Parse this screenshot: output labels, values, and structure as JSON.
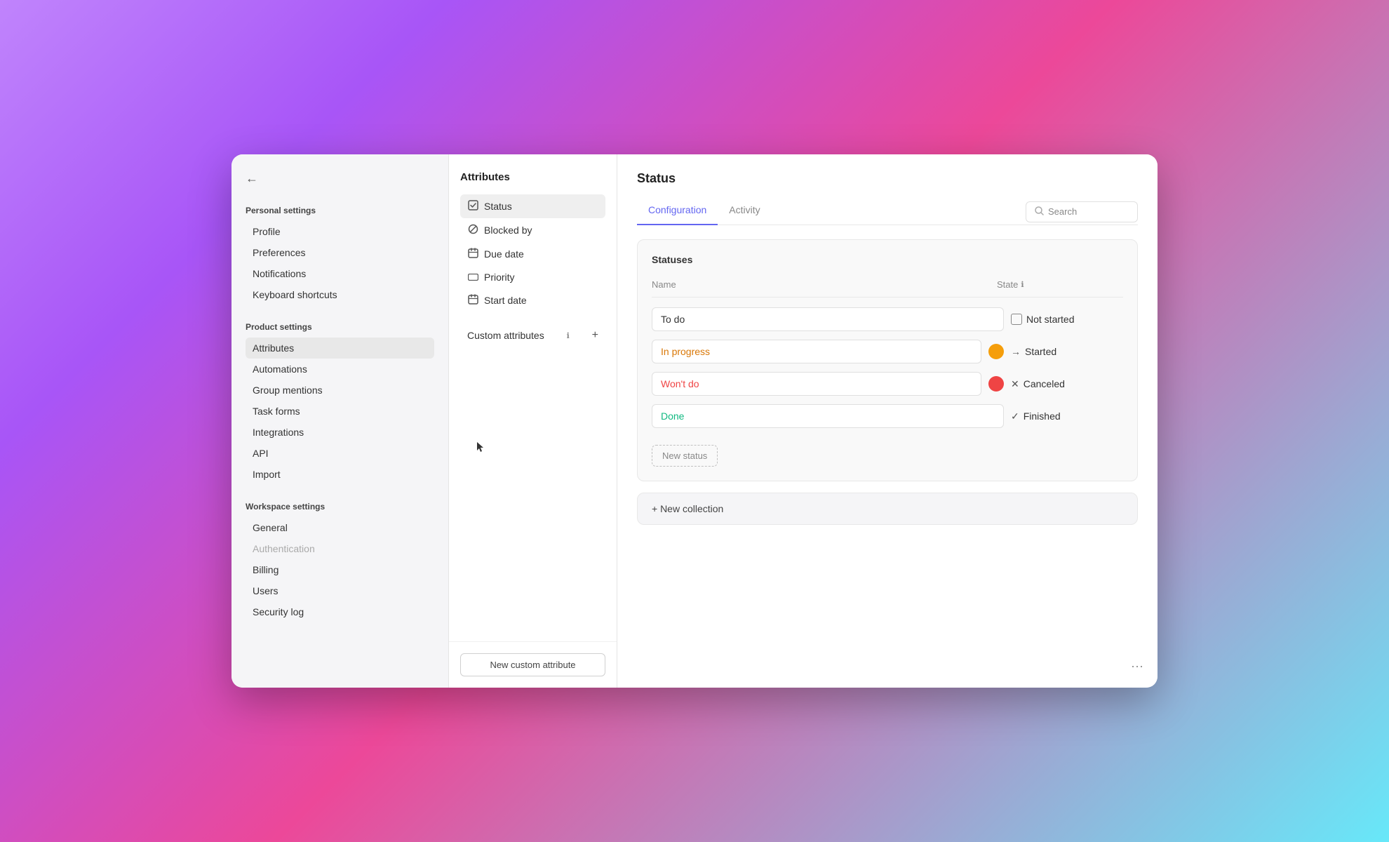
{
  "window": {
    "background": "gradient"
  },
  "sidebar": {
    "back_icon": "←",
    "personal_settings": {
      "title": "Personal settings",
      "items": [
        {
          "label": "Profile",
          "active": false,
          "muted": false
        },
        {
          "label": "Preferences",
          "active": false,
          "muted": false
        },
        {
          "label": "Notifications",
          "active": false,
          "muted": false
        },
        {
          "label": "Keyboard shortcuts",
          "active": false,
          "muted": false
        }
      ]
    },
    "product_settings": {
      "title": "Product settings",
      "items": [
        {
          "label": "Attributes",
          "active": true,
          "muted": false
        },
        {
          "label": "Automations",
          "active": false,
          "muted": false
        },
        {
          "label": "Group mentions",
          "active": false,
          "muted": false
        },
        {
          "label": "Task forms",
          "active": false,
          "muted": false
        },
        {
          "label": "Integrations",
          "active": false,
          "muted": false
        },
        {
          "label": "API",
          "active": false,
          "muted": false
        },
        {
          "label": "Import",
          "active": false,
          "muted": false
        }
      ]
    },
    "workspace_settings": {
      "title": "Workspace settings",
      "items": [
        {
          "label": "General",
          "active": false,
          "muted": false
        },
        {
          "label": "Authentication",
          "active": false,
          "muted": true
        },
        {
          "label": "Billing",
          "active": false,
          "muted": false
        },
        {
          "label": "Users",
          "active": false,
          "muted": false
        },
        {
          "label": "Security log",
          "active": false,
          "muted": false
        }
      ]
    }
  },
  "middle_panel": {
    "title": "Attributes",
    "items": [
      {
        "label": "Status",
        "icon": "☑",
        "active": true
      },
      {
        "label": "Blocked by",
        "icon": "⊘",
        "active": false
      },
      {
        "label": "Due date",
        "icon": "📅",
        "active": false
      },
      {
        "label": "Priority",
        "icon": "▭",
        "active": false
      },
      {
        "label": "Start date",
        "icon": "📅",
        "active": false
      }
    ],
    "custom_attributes": {
      "label": "Custom attributes",
      "info_label": "ℹ",
      "add_label": "+"
    },
    "new_custom_attribute_btn": "New custom attribute"
  },
  "main": {
    "title": "Status",
    "tabs": [
      {
        "label": "Configuration",
        "active": true
      },
      {
        "label": "Activity",
        "active": false
      }
    ],
    "search": {
      "placeholder": "Search",
      "icon": "🔍"
    },
    "statuses_card": {
      "title": "Statuses",
      "columns": {
        "name": "Name",
        "state": "State",
        "state_info": "ℹ"
      },
      "rows": [
        {
          "name": "To do",
          "name_color": "default",
          "dot_color": null,
          "state_icon": "□",
          "state_label": "Not started",
          "state_type": "not_started"
        },
        {
          "name": "In progress",
          "name_color": "in-progress",
          "dot_color": "yellow",
          "state_icon": "→",
          "state_label": "Started",
          "state_type": "started"
        },
        {
          "name": "Won't do",
          "name_color": "wont-do",
          "dot_color": "red",
          "state_icon": "✕",
          "state_label": "Canceled",
          "state_type": "canceled"
        },
        {
          "name": "Done",
          "name_color": "done",
          "dot_color": null,
          "state_icon": "✓",
          "state_label": "Finished",
          "state_type": "finished"
        }
      ],
      "new_status_btn": "New status"
    },
    "new_collection_btn": "+ New collection",
    "three_dots": "···"
  }
}
